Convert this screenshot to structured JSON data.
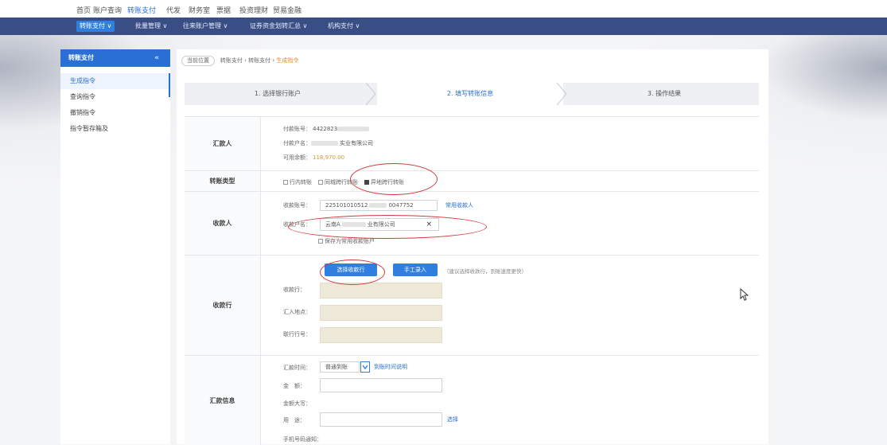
{
  "topnav": [
    "首页",
    "账户查询",
    "转账支付",
    "代发",
    "财务室",
    "票据",
    "投资理财",
    "贸易金融"
  ],
  "topnav_active": 2,
  "menubar": [
    "转账支付 ∨",
    "批量管理 ∨",
    "往来账户管理 ∨",
    "证券资金划转汇总 ∨",
    "机构支付 ∨"
  ],
  "sidebar": {
    "title": "转账支付",
    "collapse_icon": "«",
    "items": [
      "生成指令",
      "查询指令",
      "撤销指令",
      "指令暂存箱及"
    ]
  },
  "breadcrumb": {
    "loc": "当前位置",
    "path": "转账支付 › 转账支付 ›",
    "current": "生成指令"
  },
  "steps": [
    "1. 选择银行账户",
    "2. 填写转账信息",
    "3. 操作结果"
  ],
  "payer": {
    "label": "汇款人",
    "account_key": "付款账号：",
    "account_val": "4422823",
    "name_key": "付款户名：",
    "name_val": "实业有限公司",
    "balance_key": "可用余额：",
    "balance_val": "118,970.00"
  },
  "transfer_type": {
    "label": "转账类型",
    "options": [
      "行内转账",
      "同城跨行转账",
      "异地跨行转账"
    ],
    "selected": 2
  },
  "payee": {
    "label": "收款人",
    "account_key": "收款账号：",
    "account_val": "225101010512",
    "account_tail": "0047752",
    "account_link": "常用收款人",
    "name_key": "收款户名：",
    "name_val": "云南A",
    "name_tail": "业有限公司",
    "clear": "×",
    "save_label": "保存为常用收款账户"
  },
  "bank": {
    "label": "收款行",
    "select_btn": "选择收款行",
    "manual_btn": "手工录入",
    "hint": "（建议选择收款行，到账速度更快）",
    "field1": "收款行：",
    "field2": "汇入地点：",
    "field3": "联行行号："
  },
  "remit": {
    "label": "汇款信息",
    "time_key": "汇款时间：",
    "time_val": "普通到账",
    "time_link": "到账时间说明",
    "amount_key": "金　额：",
    "upper_key": "金额大写：",
    "usage_key": "用　途：",
    "usage_link": "选择",
    "more_key": "手机号码通知："
  }
}
